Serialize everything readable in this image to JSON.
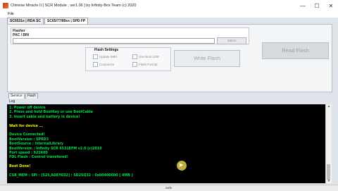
{
  "window": {
    "title": "Chinese Miracle II [ SCR Module , ver1.06 ] by Infinity-Box Team (c) 2020",
    "btn_minimize": "—",
    "btn_maximize": "☐",
    "btn_close": "✕"
  },
  "menu": {
    "file": "File"
  },
  "tabs": [
    {
      "label": "SC6531e | RDA SC",
      "active": false
    },
    {
      "label": "SC65/77/89xx | SPD FP",
      "active": true
    }
  ],
  "flasher": {
    "title": "Flasher",
    "pac_label": "PAC / BIN",
    "path_value": "",
    "select_label": "Select"
  },
  "flash_settings": {
    "title": "Flash Settings",
    "options": [
      {
        "label": "Update IMEI",
        "checked": false
      },
      {
        "label": "Use Boot LDR",
        "checked": false
      },
      {
        "label": "Customize",
        "checked": false
      },
      {
        "label": "Flash Format",
        "checked": false
      }
    ]
  },
  "buttons": {
    "write_flash": "Write Flash",
    "read_flash": "Read Flash"
  },
  "lower_tabs": [
    {
      "label": "Service",
      "active": true
    },
    {
      "label": "Flash",
      "active": false
    }
  ],
  "log": {
    "label": "Log",
    "lines": [
      {
        "text": "1. Power off device",
        "color": "#00e04a"
      },
      {
        "text": "2. Press and hold BootKey or use BootCable",
        "color": "#00e04a"
      },
      {
        "text": "3. Insert cable and battery in device!",
        "color": "#00e04a"
      },
      {
        "text": "",
        "color": "#00e04a"
      },
      {
        "text": "Wait for device ...",
        "color": "#f0f000"
      },
      {
        "text": "",
        "color": "#00e04a"
      },
      {
        "text": "Device Connected!",
        "color": "#00e04a"
      },
      {
        "text": "BootVersion : SPRD3",
        "color": "#00e04a"
      },
      {
        "text": "BootSource : InternalLibrary",
        "color": "#00e04a"
      },
      {
        "text": "BootVersion : Infinity SCR 6531EFM v2.0 (c)2019",
        "color": "#00e04a"
      },
      {
        "text": "Port speed : 921600",
        "color": "#00e04a"
      },
      {
        "text": "FDL Flash : Control transfered!",
        "color": "#00e04a"
      },
      {
        "text": "",
        "color": "#00e04a"
      },
      {
        "text": "Boot Done!",
        "color": "#f0f000"
      },
      {
        "text": "",
        "color": "#00e04a"
      },
      {
        "text": "CSB_MEM : SPI : [S25,ADEY032] : SD25Q32 : 0x00400000 [ 4MB ]",
        "color": "#00e04a"
      }
    ]
  },
  "statusbar": {
    "text": "Safe"
  }
}
